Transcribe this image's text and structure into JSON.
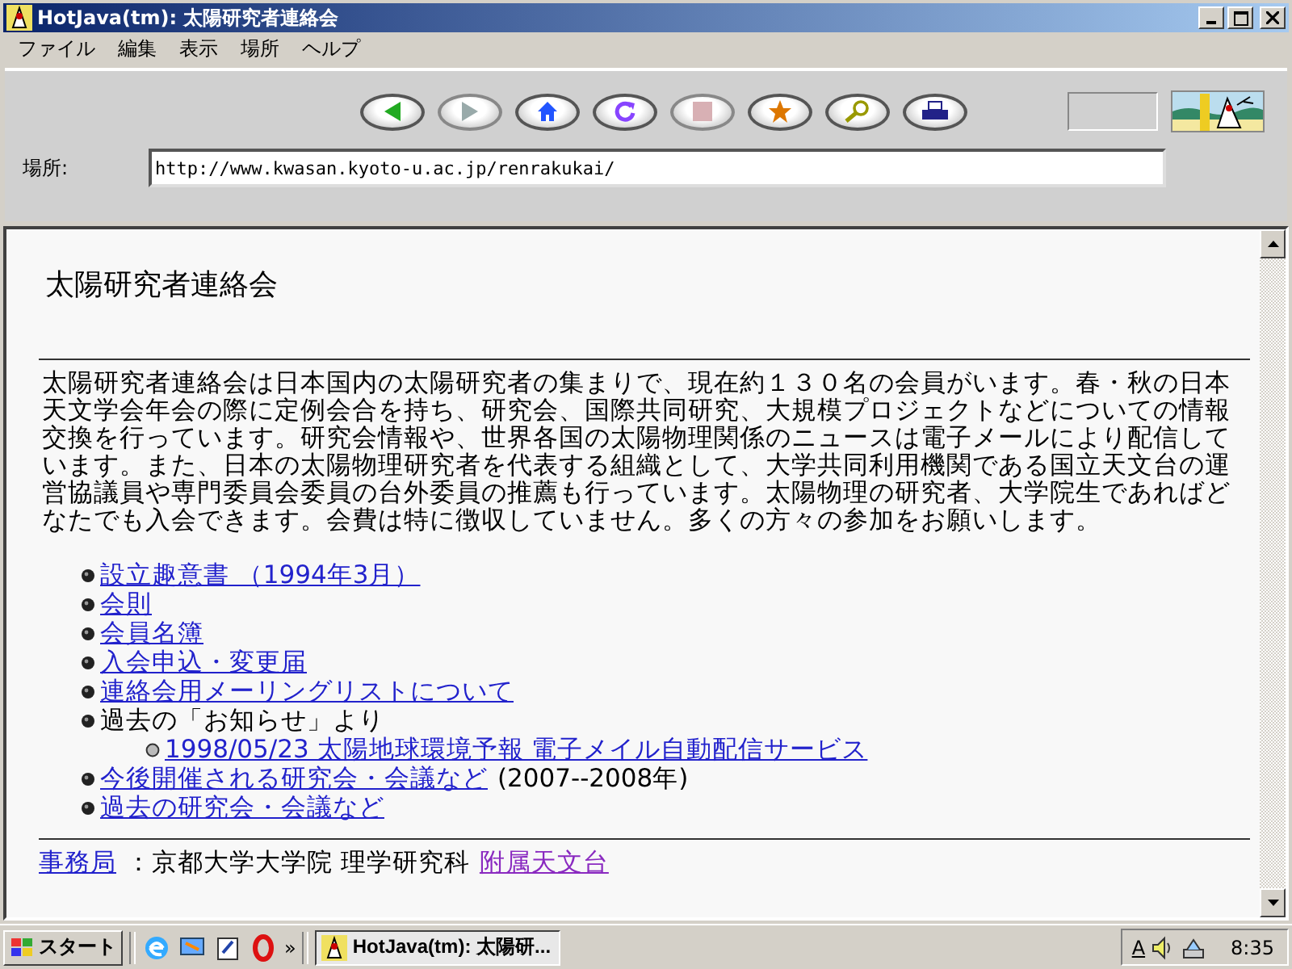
{
  "window": {
    "title": "HotJava(tm): 太陽研究者連絡会"
  },
  "menu": [
    "ファイル",
    "編集",
    "表示",
    "場所",
    "ヘルプ"
  ],
  "toolbar": {
    "buttons": [
      {
        "kind": "back",
        "disabled": false
      },
      {
        "kind": "forward",
        "disabled": true
      },
      {
        "kind": "home",
        "disabled": false
      },
      {
        "kind": "reload",
        "disabled": false
      },
      {
        "kind": "stop",
        "disabled": true
      },
      {
        "kind": "bookmark",
        "disabled": false
      },
      {
        "kind": "search",
        "disabled": false
      },
      {
        "kind": "print",
        "disabled": false
      }
    ]
  },
  "location": {
    "label": "場所:",
    "value": "http://www.kwasan.kyoto-u.ac.jp/renrakukai/"
  },
  "page": {
    "heading": "太陽研究者連絡会",
    "intro": "太陽研究者連絡会は日本国内の太陽研究者の集まりで、現在約１３０名の会員がいます。春・秋の日本天文学会年会の際に定例会合を持ち、研究会、国際共同研究、大規模プロジェクトなどについての情報交換を行っています。研究会情報や、世界各国の太陽物理関係のニュースは電子メールにより配信しています。また、日本の太陽物理研究者を代表する組織として、大学共同利用機関である国立天文台の運営協議員や専門委員会委員の台外委員の推薦も行っています。太陽物理の研究者、大学院生であればどなたでも入会できます。会費は特に徴収していません。多くの方々の参加をお願いします。",
    "items": [
      {
        "kind": "link",
        "text": "設立趣意書 （1994年3月） "
      },
      {
        "kind": "link",
        "text": "会則"
      },
      {
        "kind": "link",
        "text": "会員名簿"
      },
      {
        "kind": "link",
        "text": "入会申込・変更届"
      },
      {
        "kind": "link",
        "text": "連絡会用メーリングリストについて"
      },
      {
        "kind": "text",
        "text": "過去の「お知らせ」より",
        "children": [
          {
            "kind": "link",
            "text": "1998/05/23 太陽地球環境予報 電子メイル自動配信サービス"
          }
        ]
      },
      {
        "kind": "link",
        "text": "今後開催される研究会・会議など",
        "note": "(2007--2008年)"
      },
      {
        "kind": "link",
        "text": "過去の研究会・会議など"
      }
    ],
    "footer": [
      {
        "kind": "link",
        "text": "事務局"
      },
      {
        "kind": "text",
        "text": "：京都大学大学院 理学研究科"
      },
      {
        "kind": "link",
        "text": "附属天文台"
      }
    ]
  },
  "taskbar": {
    "start": "スタート",
    "more": "»",
    "task": "HotJava(tm): 太陽研...",
    "ime": "A",
    "clock": "8:35"
  }
}
